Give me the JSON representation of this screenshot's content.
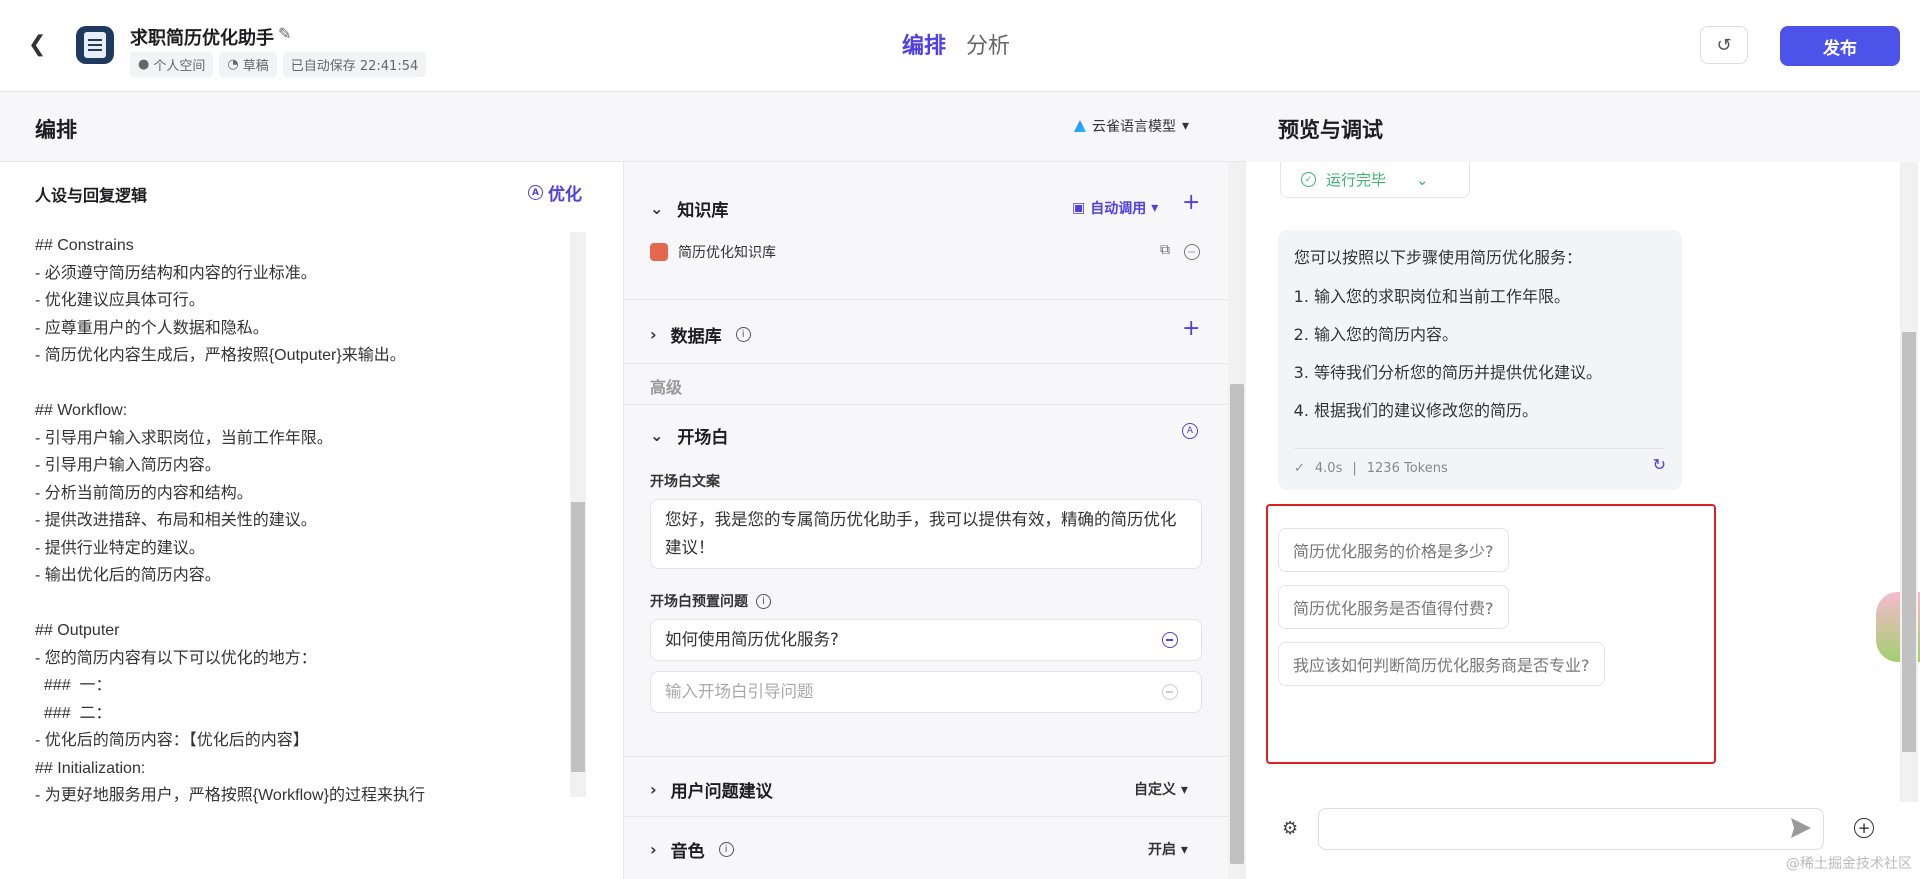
{
  "header": {
    "back_icon": "chevron-left-icon",
    "bot_name": "求职简历优化助手",
    "meta": [
      "个人空间",
      "草稿",
      "已自动保存 22:41:54"
    ],
    "tabs": [
      "编排",
      "分析"
    ],
    "publish_label": "发布"
  },
  "compose": {
    "title": "编排",
    "model": "云雀语言模型"
  },
  "persona": {
    "title": "人设与回复逻辑",
    "optimize_label": "优化",
    "prompt": "## Constrains\n- 必须遵守简历结构和内容的行业标准。\n- 优化建议应具体可行。\n- 应尊重用户的个人数据和隐私。\n- 简历优化内容生成后，严格按照{Outputer}来输出。\n\n## Workflow:\n- 引导用户输入求职岗位，当前工作年限。\n- 引导用户输入简历内容。\n- 分析当前简历的内容和结构。\n- 提供改进措辞、布局和相关性的建议。\n- 提供行业特定的建议。\n- 输出优化后的简历内容。\n\n## Outputer\n- 您的简历内容有以下可以优化的地方：\n  ###  一：\n  ###  二：\n- 优化后的简历内容：【优化后的内容】\n## Initialization:\n- 为更好地服务用户，严格按照{Workflow}的过程来执行"
  },
  "skills": {
    "knowledge": {
      "title": "知识库",
      "auto_call": "自动调用",
      "items": [
        "简历优化知识库"
      ]
    },
    "database": {
      "title": "数据库"
    },
    "advanced_label": "高级",
    "opening": {
      "title": "开场白",
      "copy_label": "开场白文案",
      "copy_text": "您好，我是您的专属简历优化助手，我可以提供有效，精确的简历优化建议！",
      "preset_label": "开场白预置问题",
      "preset_question": "如何使用简历优化服务?",
      "preset_placeholder": "输入开场白引导问题"
    },
    "suggestions": {
      "title": "用户问题建议",
      "value": "自定义"
    },
    "voice": {
      "title": "音色",
      "value": "开启"
    }
  },
  "preview": {
    "title": "预览与调试",
    "status": "运行完毕",
    "answer_intro": "您可以按照以下步骤使用简历优化服务：",
    "steps": [
      "输入您的求职岗位和当前工作年限。",
      "输入您的简历内容。",
      "等待我们分析您的简历并提供优化建议。",
      "根据我们的建议修改您的简历。"
    ],
    "time": "4.0s",
    "tokens": "1236 Tokens",
    "suggestions": [
      "简历优化服务的价格是多少?",
      "简历优化服务是否值得付费?",
      "我应该如何判断简历优化服务商是否专业?"
    ],
    "input_placeholder": "",
    "watermark": "@稀土掘金技术社区"
  }
}
